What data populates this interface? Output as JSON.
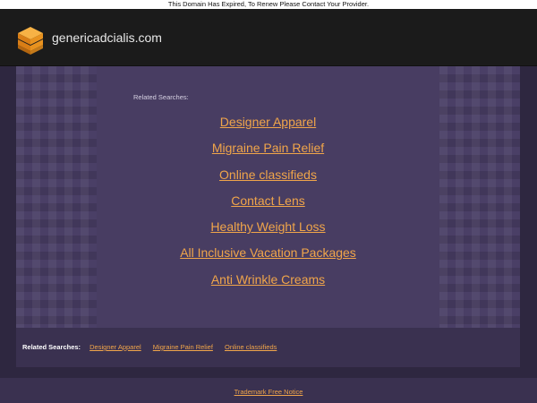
{
  "notice": {
    "text": "This Domain Has Expired, To Renew Please Contact Your Provider."
  },
  "header": {
    "site_name": "genericadcialis.com",
    "logo_icon": "stacked-layers-icon"
  },
  "main": {
    "related_label": "Related Searches:",
    "links": [
      "Designer Apparel",
      "Migraine Pain Relief",
      "Online classifieds",
      "Contact Lens",
      "Healthy Weight Loss",
      "All Inclusive Vacation Packages",
      "Anti Wrinkle Creams"
    ]
  },
  "footer_related": {
    "label": "Related Searches:",
    "links": [
      "Designer Apparel",
      "Migraine Pain Relief",
      "Online classifieds"
    ]
  },
  "trademark": {
    "text": "Trademark Free Notice"
  },
  "colors": {
    "accent_link": "#f0a54a",
    "panel": "#4a3f66",
    "header_bg": "#1b1b1b",
    "logo_orange": "#f39a2a"
  }
}
